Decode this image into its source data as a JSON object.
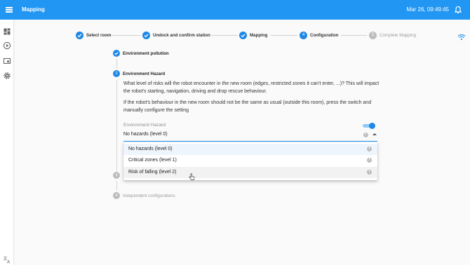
{
  "header": {
    "title": "Mapping",
    "datetime": "Mar 26, 09:49:45",
    "accent": "#2196f3"
  },
  "sidebar": {
    "icons": [
      "dashboard-icon",
      "play-icon",
      "media-icon",
      "settings-icon",
      "translate-icon"
    ]
  },
  "stepper": {
    "steps": [
      {
        "label": "Select room",
        "state": "done"
      },
      {
        "label": "Undock and confirm station",
        "state": "done"
      },
      {
        "label": "Mapping",
        "state": "done"
      },
      {
        "label": "Configuration",
        "number": "4",
        "state": "active"
      },
      {
        "label": "Complete Mapping",
        "number": "5",
        "state": "pending"
      }
    ]
  },
  "substeps": {
    "env_pollution": {
      "label": "Environment pollution",
      "state": "done"
    },
    "env_hazard": {
      "label": "Environment Hazard",
      "number": "2"
    },
    "step3": {
      "label": "",
      "number": "3"
    },
    "independent": {
      "label": "Independent configurations",
      "number": "4"
    }
  },
  "hazard": {
    "description": "What level of risks will the robot encounter in the new room (edges, restricted zones it can't enter, ...)? This will impact the robot's starting, navigation, driving and drop rescue behaviour.",
    "instruction": "If the robot's behaviour in the new room should not be the same as usual (outside this room), press the switch and manually configure the setting",
    "field_label": "Environment Hazard",
    "toggle_on": true,
    "selected_value": "No hazards (level 0)",
    "options": [
      {
        "label": "No hazards (level 0)",
        "selected": true
      },
      {
        "label": "Critical zones (level 1)"
      },
      {
        "label": "Risk of falling (level 2)",
        "hovered": true
      }
    ],
    "info_glyph": "i"
  }
}
